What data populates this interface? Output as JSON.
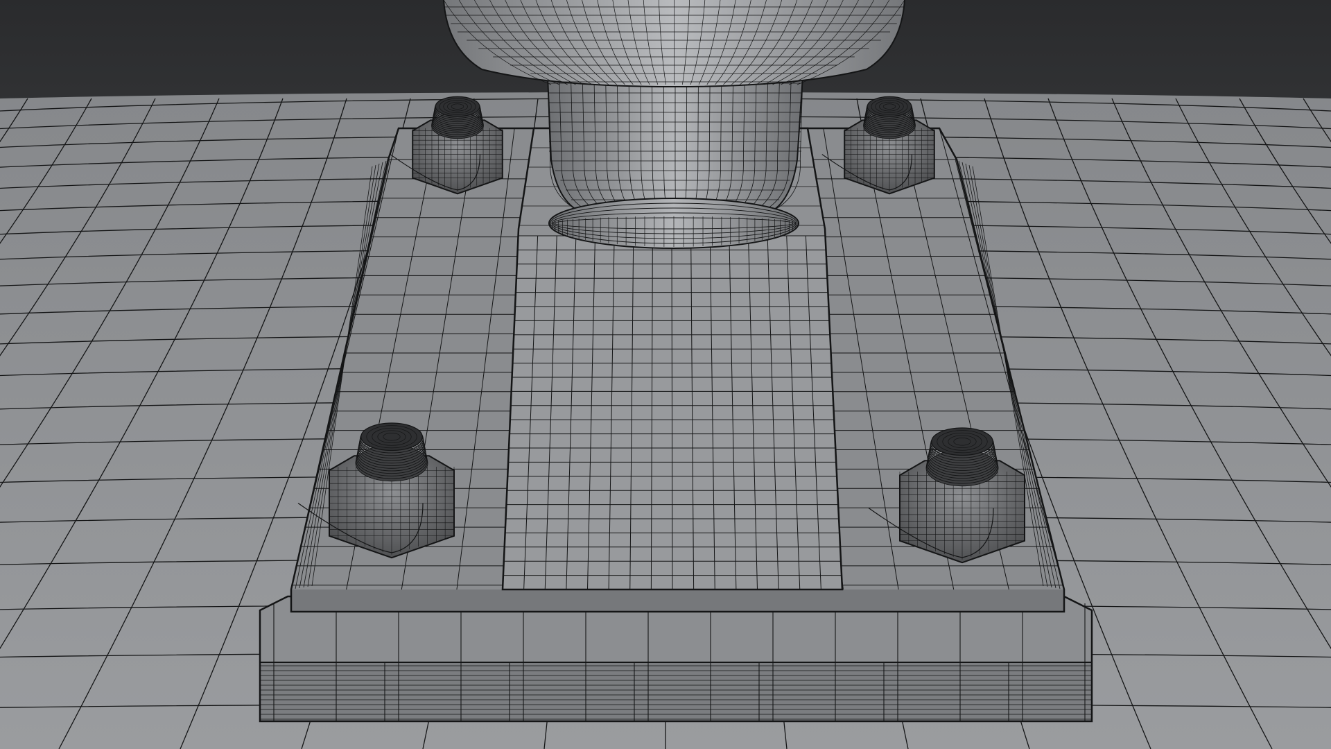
{
  "scene": {
    "subject": "wireframe-render-bolted-base-plate",
    "colors": {
      "background_top": "#2a2b2d",
      "background_bottom": "#6c6e71",
      "surface": "#8e9093",
      "surface_light": "#a3a5a8",
      "surface_dark": "#6d6f72",
      "wire": "#141516"
    },
    "objects": [
      "ground-surface",
      "base-plate",
      "pedestal-block",
      "column-collar",
      "column-shaft",
      "column-cap",
      "bolt-nut-top-left",
      "bolt-nut-top-right",
      "bolt-nut-bottom-left",
      "bolt-nut-bottom-right"
    ]
  }
}
